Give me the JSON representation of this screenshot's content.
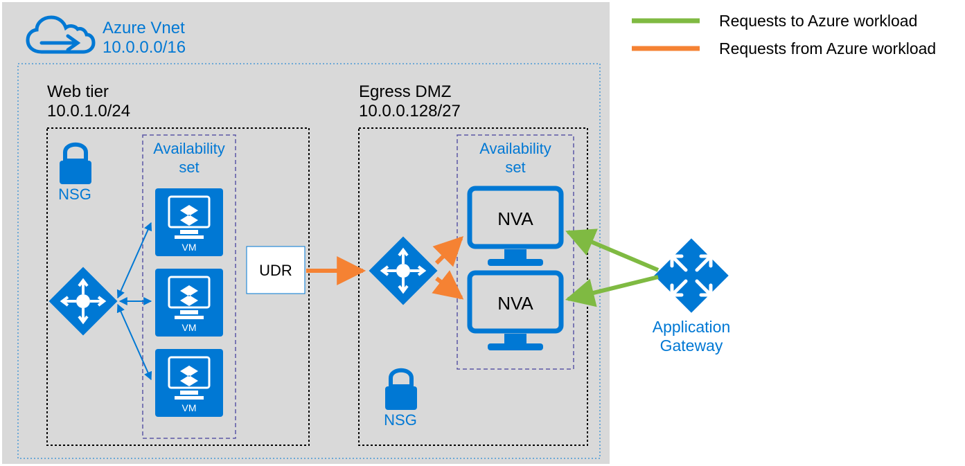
{
  "vnet": {
    "title": "Azure Vnet",
    "cidr": "10.0.0.0/16"
  },
  "web_tier": {
    "title": "Web tier",
    "cidr": "10.0.1.0/24",
    "nsg_label": "NSG",
    "availability_label": "Availability set",
    "vm_label": "VM",
    "udr_label": "UDR"
  },
  "egress_dmz": {
    "title": "Egress DMZ",
    "cidr": "10.0.0.128/27",
    "nsg_label": "NSG",
    "availability_label": "Availability set",
    "nva_label": "NVA"
  },
  "gateway": {
    "title_line1": "Application",
    "title_line2": "Gateway"
  },
  "legend": {
    "to_workload": "Requests to Azure workload",
    "from_workload": "Requests from Azure workload"
  },
  "colors": {
    "azure_blue": "#0078d4",
    "light_gray": "#d9d9d9",
    "green": "#7fba42",
    "orange": "#f58233",
    "dotted_dark": "#000",
    "purple_dash": "#5b57a6"
  }
}
